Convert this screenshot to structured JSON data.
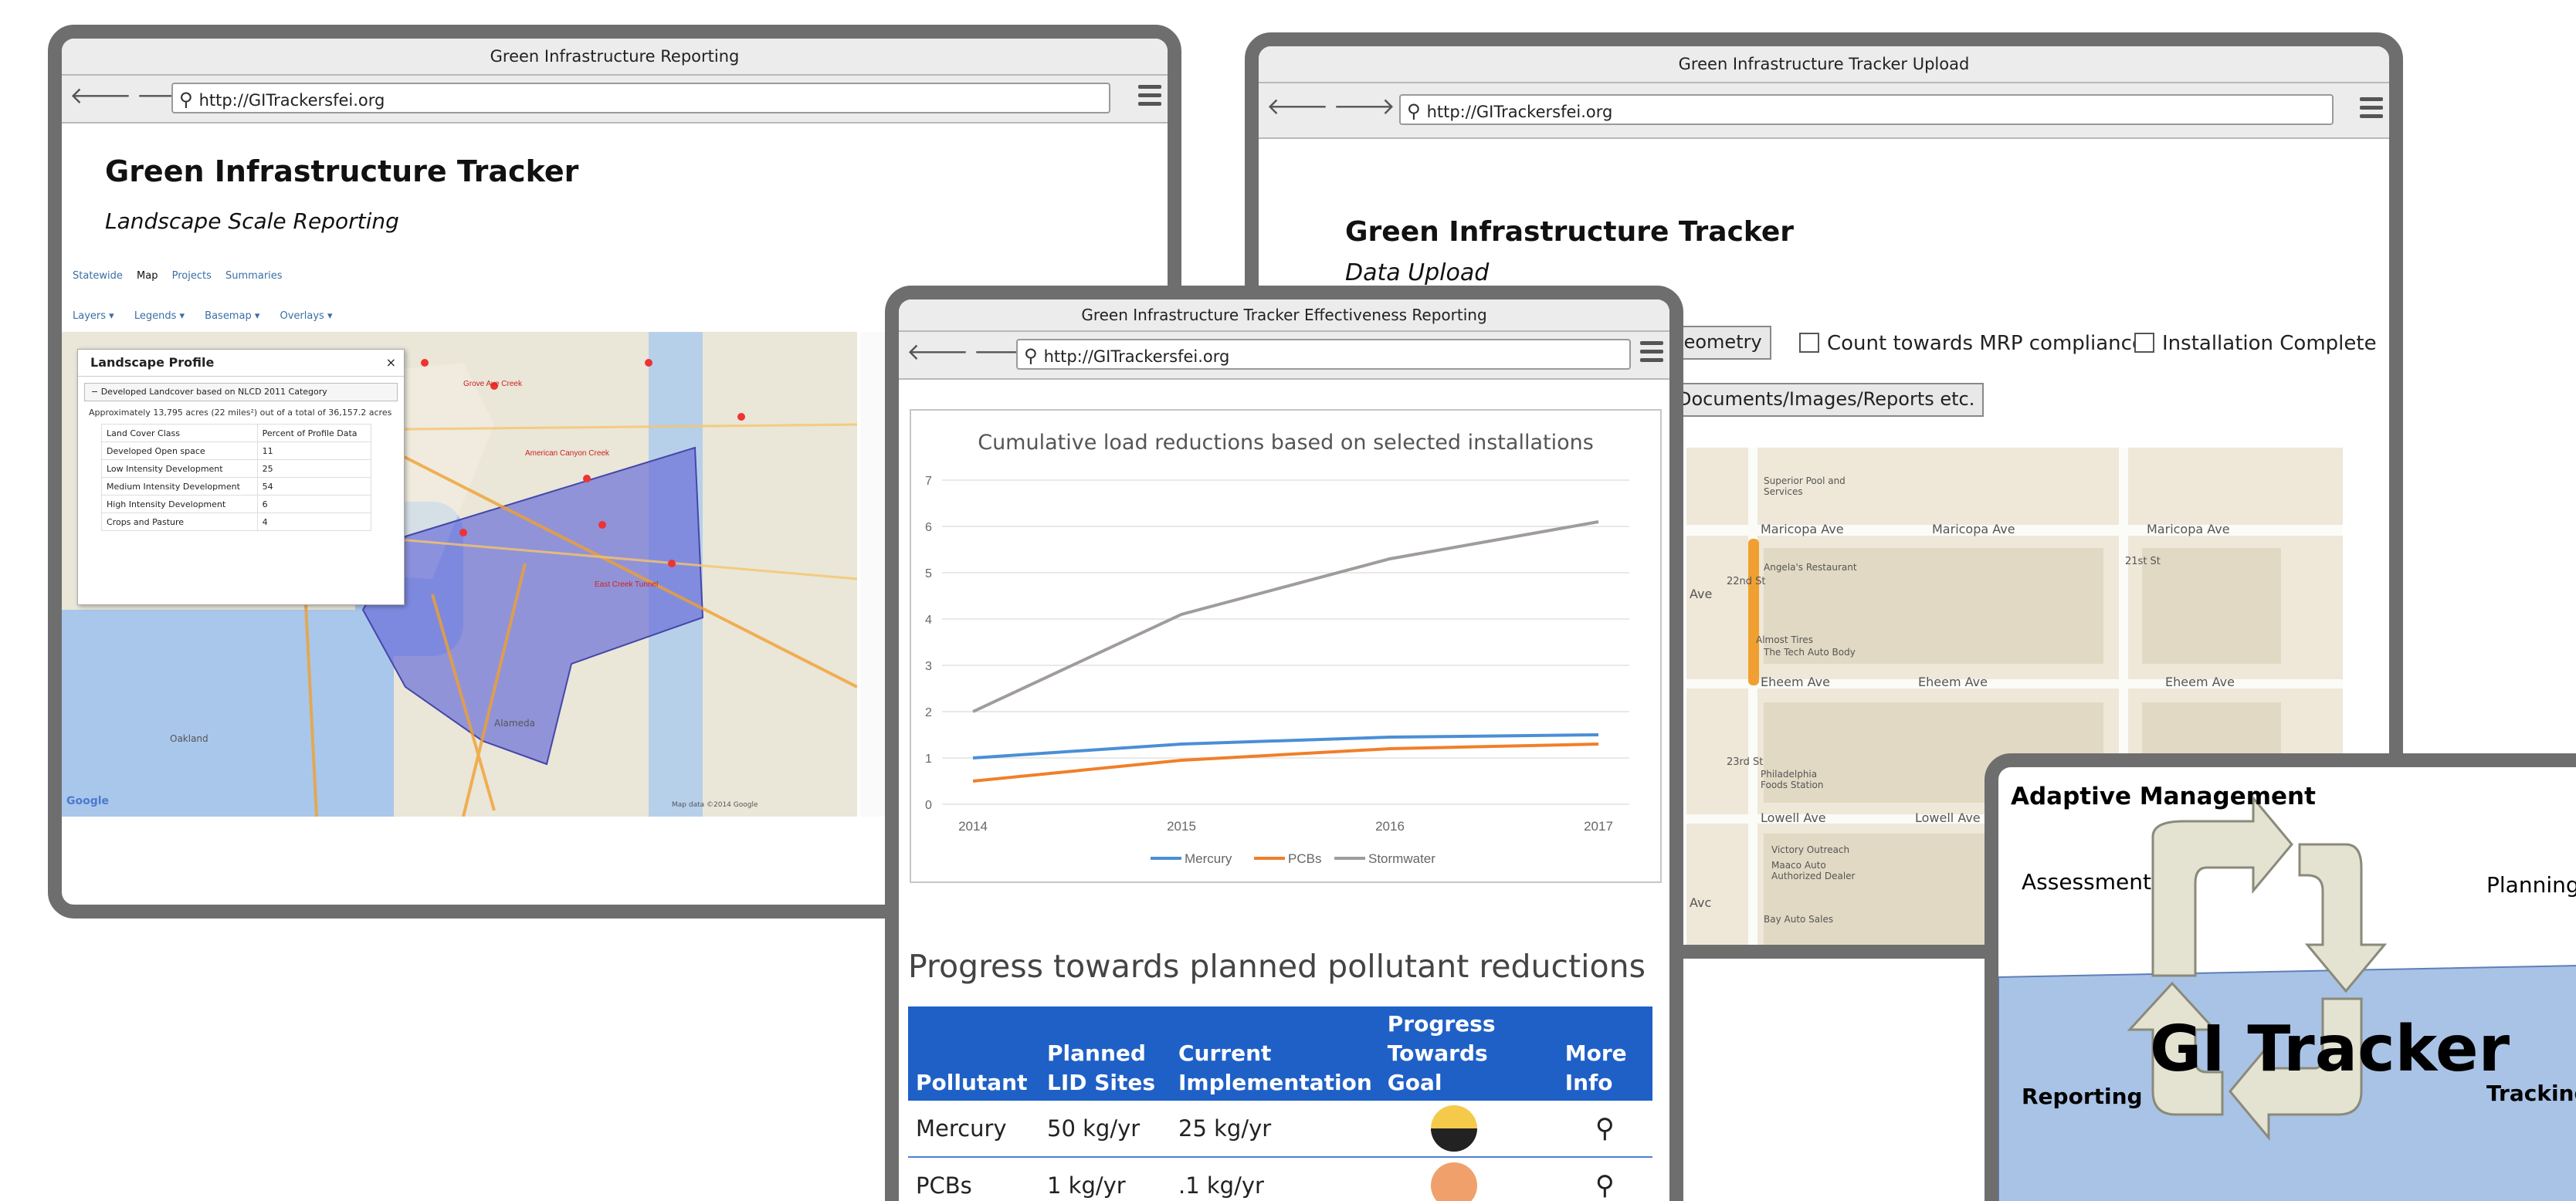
{
  "reporting_window": {
    "title": "Green Infrastructure Reporting",
    "url": "http://GITrackersfei.org",
    "heading": "Green Infrastructure Tracker",
    "subheading": "Landscape Scale Reporting",
    "tabs": [
      "Statewide",
      "Map",
      "Projects",
      "Summaries"
    ],
    "layer_controls": [
      "Layers ▾",
      "Legends ▾",
      "Basemap ▾",
      "Overlays ▾"
    ],
    "profile": {
      "title": "Landscape Profile",
      "close": "×",
      "section": "− Developed Landcover based on NLCD 2011 Category",
      "note": "Approximately 13,795 acres (22 miles²) out of a total of 36,157.2 acres",
      "col_headers": [
        "Land Cover Class",
        "Percent of Profile Data"
      ],
      "rows": [
        [
          "Developed Open space",
          "11"
        ],
        [
          "Low Intensity Development",
          "25"
        ],
        [
          "Medium Intensity Development",
          "54"
        ],
        [
          "High Intensity Development",
          "6"
        ],
        [
          "Crops and Pasture",
          "4"
        ]
      ]
    },
    "map_labels": [
      "Oakland",
      "Alameda",
      "Google",
      "Map data ©2014 Google"
    ]
  },
  "upload_window": {
    "title": "Green Infrastructure Tracker Upload",
    "url": "http://GITrackersfei.org",
    "heading": "Green Infrastructure Tracker",
    "subheading": "Data Upload",
    "geometry_button": "Geometry",
    "mrp_checkbox": "Count towards MRP compliance",
    "install_checkbox": "Installation Complete",
    "upload_button": "Documents/Images/Reports etc.",
    "map_labels": {
      "street1": "Maricopa Ave",
      "street1b": "Maricopa Ave",
      "street1c": "Maricopa Ave",
      "street2": "Eheem Ave",
      "street2b": "Eheem Ave",
      "street2c": "Eheem Ave",
      "street3": "Lowell Ave",
      "street3b": "Lowell Ave",
      "poi1": "Superior Pool and Services",
      "poi2": "Angela's Restaurant",
      "poi3": "Almost Tires",
      "poi4": "The Tech Auto Body",
      "poi5": "Philadelphia Foods Station",
      "poi6": "Victory Outreach",
      "poi7": "Maaco Auto Authorized Dealer",
      "poi8": "Bay Auto Sales",
      "ave": "Ave",
      "st22": "22nd St",
      "st23": "23rd St",
      "st21": "21st St",
      "avc": "Avc"
    }
  },
  "effectiveness_window": {
    "title": "Green Infrastructure Tracker Effectiveness Reporting",
    "url": "http://GITrackersfei.org",
    "progress_title": "Progress towards planned pollutant reductions",
    "table_headers": [
      "Pollutant",
      "Planned LID Sites",
      "Current Implementation",
      "Progress Towards Goal",
      "More Info"
    ],
    "table_rows": [
      {
        "pollutant": "Mercury",
        "planned": "50 kg/yr",
        "current": "25 kg/yr",
        "color": "#f5c94a",
        "fill": 0.5
      },
      {
        "pollutant": "PCBs",
        "planned": "1 kg/yr",
        "current": ".1 kg/yr",
        "color": "#f0a06a",
        "fill": 0.1
      }
    ],
    "more_info_icon": "location-pin-icon"
  },
  "chart_data": {
    "type": "line",
    "title": "Cumulative load reductions based on selected installations",
    "x": [
      2014,
      2015,
      2016,
      2017
    ],
    "y_ticks": [
      0,
      1,
      2,
      3,
      4,
      5,
      6,
      7
    ],
    "ylim": [
      0,
      7
    ],
    "grid": true,
    "legend_position": "bottom",
    "series": [
      {
        "name": "Mercury",
        "color": "#4a8fd6",
        "values": [
          1.0,
          1.3,
          1.45,
          1.5
        ]
      },
      {
        "name": "PCBs",
        "color": "#f07f2a",
        "values": [
          0.5,
          0.95,
          1.2,
          1.3
        ]
      },
      {
        "name": "Stormwater",
        "color": "#a09c9a",
        "values": [
          2.0,
          4.1,
          5.3,
          6.1
        ]
      }
    ]
  },
  "adaptive_window": {
    "title": "Adaptive Management",
    "assessment": "Assessment",
    "planning": "Planning",
    "reporting": "Reporting",
    "tracking": "Tracking",
    "logo": "GI Tracker"
  }
}
